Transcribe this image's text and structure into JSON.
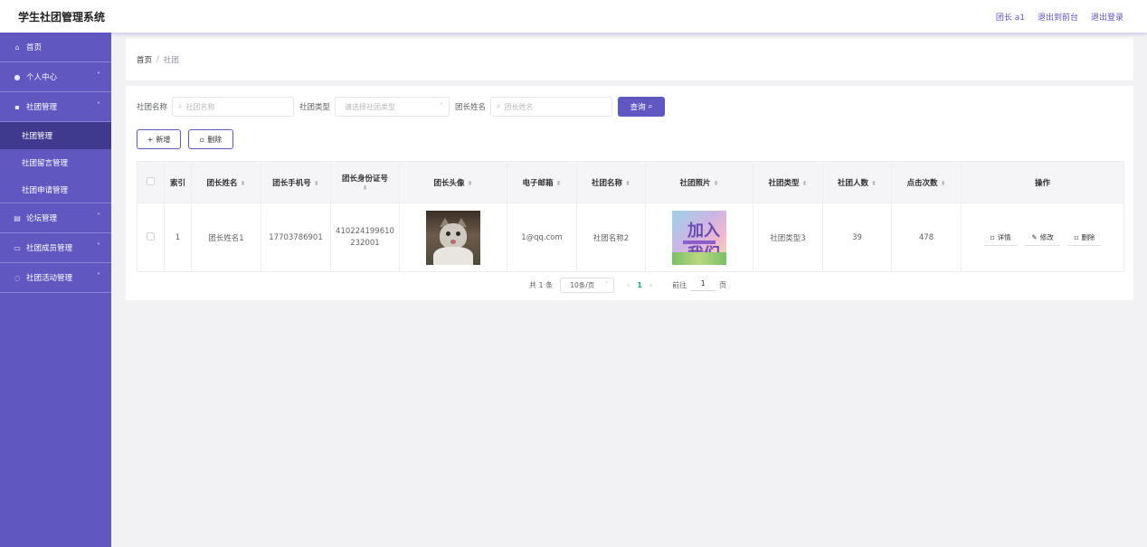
{
  "header": {
    "title": "学生社团管理系统",
    "user_label": "团长 a1",
    "to_front": "退出到前台",
    "logout": "退出登录"
  },
  "sidebar": {
    "items": [
      {
        "label": "首页",
        "icon": "home-icon"
      },
      {
        "label": "个人中心",
        "icon": "user-icon"
      },
      {
        "label": "社团管理",
        "icon": "folder-icon"
      },
      {
        "label": "论坛管理",
        "icon": "forum-icon"
      },
      {
        "label": "社团成员管理",
        "icon": "members-icon"
      },
      {
        "label": "社团活动管理",
        "icon": "activity-icon"
      }
    ],
    "sub_items": [
      {
        "label": "社团管理",
        "active": true
      },
      {
        "label": "社团留言管理"
      },
      {
        "label": "社团申请管理"
      }
    ]
  },
  "breadcrumb": {
    "home": "首页",
    "sep": "/",
    "current": "社团"
  },
  "search": {
    "club_name_label": "社团名称",
    "club_name_placeholder": "社团名称",
    "club_type_label": "社团类型",
    "club_type_placeholder": "请选择社团类型",
    "leader_name_label": "团长姓名",
    "leader_name_placeholder": "团长姓名",
    "query_label": "查询"
  },
  "actions": {
    "add_label": "新增",
    "delete_label": "删除"
  },
  "table": {
    "headers": {
      "index": "索引",
      "leader_name": "团长姓名",
      "leader_phone": "团长手机号",
      "leader_id": "团长身份证号",
      "leader_avatar": "团长头像",
      "email": "电子邮箱",
      "club_name": "社团名称",
      "club_photo": "社团照片",
      "club_type": "社团类型",
      "member_count": "社团人数",
      "clicks": "点击次数",
      "ops": "操作"
    },
    "rows": [
      {
        "index": "1",
        "leader_name": "团长姓名1",
        "leader_phone": "17703786901",
        "leader_id": "410224199610232001",
        "email": "1@qq.com",
        "club_name": "社团名称2",
        "club_photo_text": "加入我们",
        "club_type": "社团类型3",
        "member_count": "39",
        "clicks": "478",
        "op_detail": "详情",
        "op_edit": "修改",
        "op_delete": "删除"
      }
    ]
  },
  "pager": {
    "total": "共 1 条",
    "page_size": "10条/页",
    "current_page": "1",
    "goto_label": "前往",
    "goto_value": "1",
    "page_suffix": "页"
  },
  "colors": {
    "accent": "#5f58c0",
    "sidebar_active": "#3f3a8e",
    "page_active": "#2c9d86"
  }
}
